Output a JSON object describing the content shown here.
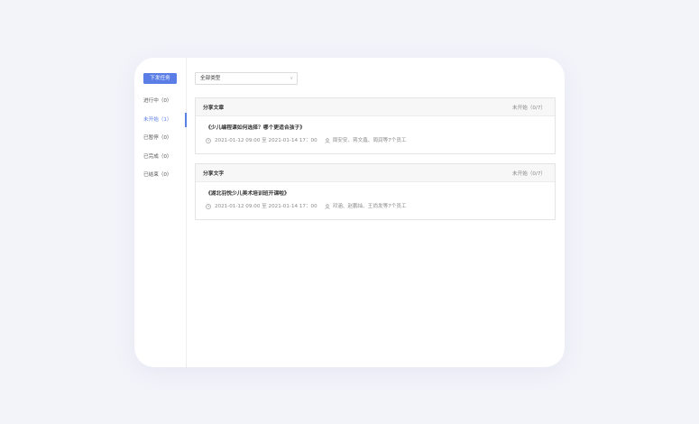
{
  "sidebar": {
    "new_task_label": "下发任务",
    "items": [
      {
        "label": "进行中（0）",
        "active": false
      },
      {
        "label": "未开始（1）",
        "active": true
      },
      {
        "label": "已暂停（0）",
        "active": false
      },
      {
        "label": "已完成（0）",
        "active": false
      },
      {
        "label": "已结束（0）",
        "active": false
      }
    ]
  },
  "filter": {
    "type_select_value": "全部类型"
  },
  "tasks": [
    {
      "type": "分享文章",
      "status": "未开始（0/7）",
      "title": "《少儿编程课如何选择？哪个更适合孩子》",
      "time_range": "2021-01-12 09:00 至 2021-01-14 17：00",
      "members": "周安安、蒋文鑫、周润等7个员工"
    },
    {
      "type": "分享文字",
      "status": "未开始（0/7）",
      "title": "《湖北羽悦少儿美术培训班开课啦》",
      "time_range": "2021-01-12 09:00 至 2021-01-14 17：00",
      "members": "邓涵、赵鹏灿、王尚发等7个员工"
    }
  ],
  "colors": {
    "accent": "#5b7ee6",
    "background": "#f3f4fa",
    "card": "#ffffff"
  },
  "icons": {
    "select_chevron": "chevron-down-icon",
    "time": "clock-icon",
    "members": "user-icon"
  }
}
